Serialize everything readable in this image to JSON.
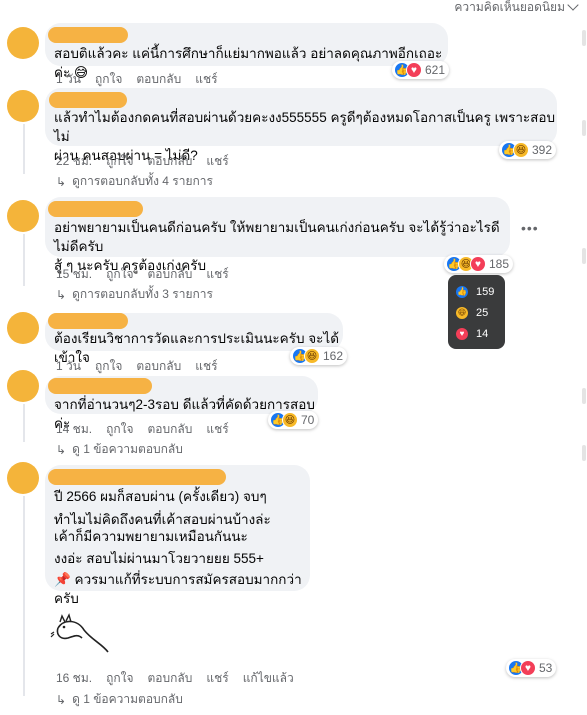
{
  "sort_label": "ความคิดเห็นยอดนิยม",
  "action_labels": {
    "like": "ถูกใจ",
    "reply": "ตอบกลับ",
    "share": "แชร์",
    "edited": "แก้ไขแล้ว"
  },
  "colors": {
    "like": "#1877f2",
    "haha": "#f7b928",
    "love": "#f33e58",
    "name_redaction": "#f6ae3a"
  },
  "comments": [
    {
      "text": "สอบติแล้วคะ แค่นี้การศึกษาก็แย่มากพอแล้ว อย่าลดคุณภาพอีกเถอะค่ะ 😅",
      "time": "1 วัน",
      "reactions": [
        "like",
        "love"
      ],
      "reaction_count": "621"
    },
    {
      "text": "แล้วทำไมต้องกดคนที่สอบผ่านด้วยคะงง555555 ครูดีๆต้องหมดโอกาสเป็นครู เพราะสอบไม่\nผ่าน คนสอบผ่าน = ไม่ดี?",
      "time": "22 ชม.",
      "reactions": [
        "like",
        "haha"
      ],
      "reaction_count": "392",
      "replies": "ดูการตอบกลับทั้ง 4 รายการ"
    },
    {
      "text": "อย่าพยายามเป็นคนดีก่อนครับ ให้พยายามเป็นคนเก่งก่อนครับ จะได้รู้ว่าอะไรดีไม่ดีครับ\nสู้ ๆ นะครับ ครูต้องเก่งครับ",
      "time": "15 ชม.",
      "reactions": [
        "like",
        "haha",
        "love"
      ],
      "reaction_count": "185",
      "replies": "ดูการตอบกลับทั้ง 3 รายการ",
      "breakdown": [
        {
          "type": "like",
          "count": "159"
        },
        {
          "type": "haha",
          "count": "25"
        },
        {
          "type": "love",
          "count": "14"
        }
      ]
    },
    {
      "text": "ต้องเรียนวิชาการวัดและการประเมินนะครับ จะได้เข้าใจ",
      "time": "1 วัน",
      "reactions": [
        "like",
        "haha"
      ],
      "reaction_count": "162"
    },
    {
      "text": "จากที่อ่านวนๆ2-3รอบ ดีแล้วที่คัดด้วยการสอบค่ะ",
      "time": "14 ชม.",
      "reactions": [
        "like",
        "haha"
      ],
      "reaction_count": "70",
      "replies": "ดู 1 ข้อความตอบกลับ"
    },
    {
      "text_lines": [
        "ปี 2566 ผมก็สอบผ่าน (ครั้งเดียว) จบๆ",
        "ทำไมไม่คิดถึงคนที่เค้าสอบผ่านบ้างล่ะ",
        "เค้าก็มีความพยายามเหมือนกันนะ",
        "งงอ่ะ สอบไม่ผ่านมาโวยวายยย 555+",
        "📌 ควรมาแก้ที่ระบบการสมัครสอบมากกว่าครับ"
      ],
      "time": "16 ชม.",
      "reactions": [
        "like",
        "love"
      ],
      "reaction_count": "53",
      "replies": "ดู 1 ข้อความตอบกลับ",
      "edited": true
    }
  ]
}
